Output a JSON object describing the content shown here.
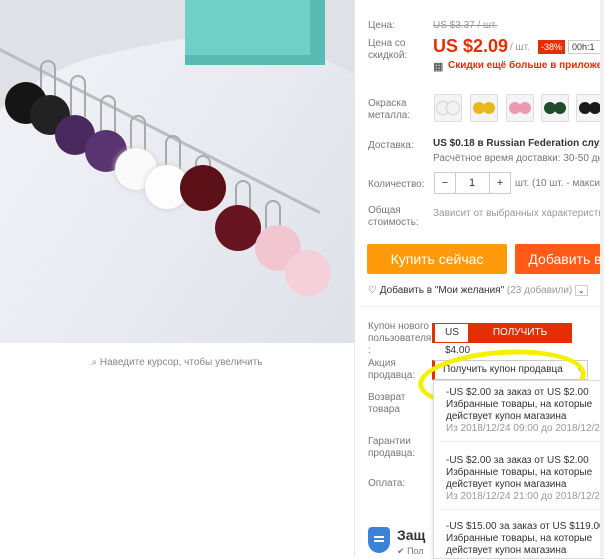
{
  "product": {
    "zoom_hint": "Наведите курсор, чтобы увеличить"
  },
  "price": {
    "label": "Цена:",
    "old": "US $3.37 / шт.",
    "discount_label": "Цена со скидкой:",
    "new": "US $2.09",
    "unit": "/ шт.",
    "discount": "-38%",
    "timer": "00h:1",
    "app_promo": "Скидки ещё больше в приложени"
  },
  "color": {
    "label": "Окраска металла:",
    "swatches": [
      {
        "name": "white",
        "color": "#f2f2f2"
      },
      {
        "name": "yellow",
        "color": "#e9b81f"
      },
      {
        "name": "pink",
        "color": "#e99ab0"
      },
      {
        "name": "green",
        "color": "#1f4d2b"
      },
      {
        "name": "black",
        "color": "#1a1a1a"
      }
    ]
  },
  "delivery": {
    "label": "Доставка:",
    "value": "US $0.18 в Russian Federation служб",
    "eta": "Расчётное время доставки: 30-50 дн"
  },
  "quantity": {
    "label": "Количество:",
    "minus": "−",
    "value": "1",
    "plus": "+",
    "note": "шт. (10 шт. - макси"
  },
  "total": {
    "label": "Общая стоимость:",
    "value": "Зависит от выбранных характеристи"
  },
  "actions": {
    "buy": "Купить сейчас",
    "cart": "Добавить в"
  },
  "wishlist": {
    "text": "Добавить в \"Мои желания\"",
    "count": "(23 добавили)"
  },
  "coupon_new": {
    "label": "Купон нового пользователя :",
    "amount": "US $4.00",
    "get": "ПОЛУЧИТЬ"
  },
  "seller_promo": {
    "label": "Акция продавца:",
    "dropdown": "Получить купон продавца",
    "items": [
      {
        "line1": "-US $2.00 за заказ от US $2.00",
        "line2": "Избранные товары, на которые",
        "line3": "действует купон магазина",
        "date": "Из 2018/12/24 09:00 до 2018/12/27 0"
      },
      {
        "line1": "-US $2.00 за заказ от US $2.00",
        "line2": "Избранные товары, на которые",
        "line3": "действует купон магазина",
        "date": "Из 2018/12/24 21:00 до 2018/12/26 0"
      },
      {
        "line1": "-US $15.00 за заказ от US $119.00",
        "line2": "Избранные товары, на которые",
        "line3": "действует купон магазина",
        "date": ""
      }
    ]
  },
  "returns": {
    "label": "Возврат товара"
  },
  "guarantee": {
    "label": "Гарантии продавца:"
  },
  "payment": {
    "label": "Оплата:"
  },
  "protection": {
    "label": "Защ",
    "sub": "Пол"
  }
}
